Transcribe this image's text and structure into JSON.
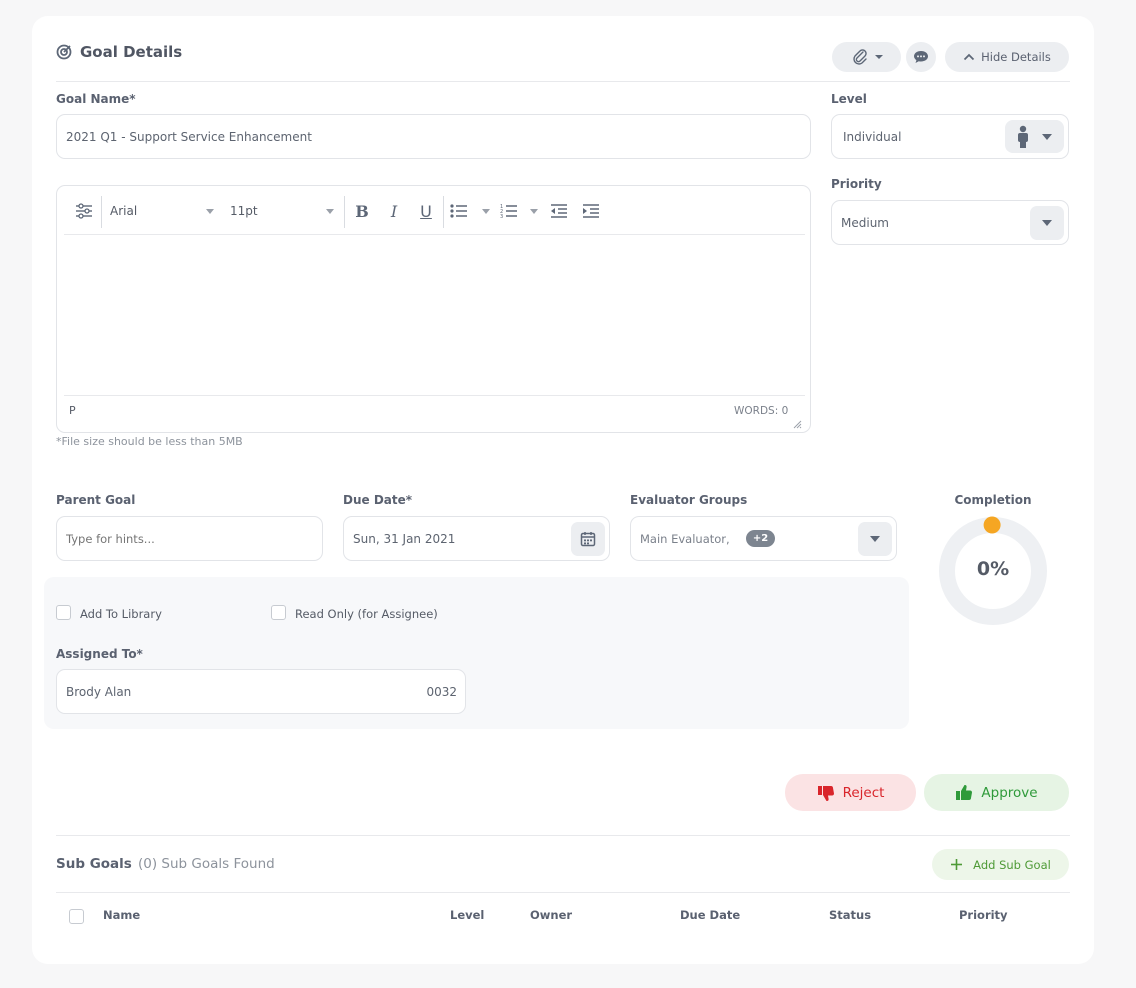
{
  "header": {
    "title": "Goal Details",
    "hide_details_label": "Hide Details"
  },
  "goal_name": {
    "label": "Goal Name*",
    "value": "2021 Q1 - Support Service Enhancement"
  },
  "level": {
    "label": "Level",
    "value": "Individual"
  },
  "priority": {
    "label": "Priority",
    "value": "Medium"
  },
  "editor": {
    "font": "Arial",
    "size": "11pt",
    "status_tag": "P",
    "word_count": "WORDS: 0",
    "file_note": "*File size should be less than 5MB"
  },
  "parent_goal": {
    "label": "Parent Goal",
    "placeholder": "Type for hints..."
  },
  "due_date": {
    "label": "Due Date*",
    "value": "Sun, 31 Jan 2021"
  },
  "evaluator_groups": {
    "label": "Evaluator Groups",
    "value": "Main Evaluator,",
    "extra_count": "+2"
  },
  "completion": {
    "label": "Completion",
    "percent_text": "0%",
    "value": 0
  },
  "options": {
    "add_to_library": "Add To Library",
    "read_only": "Read Only (for Assignee)"
  },
  "assigned_to": {
    "label": "Assigned To*",
    "name": "Brody Alan",
    "code": "0032"
  },
  "actions": {
    "reject": "Reject",
    "approve": "Approve"
  },
  "sub_goals": {
    "title": "Sub Goals",
    "count_text": "(0) Sub Goals Found",
    "add_label": "Add Sub Goal",
    "columns": [
      "Name",
      "Level",
      "Owner",
      "Due Date",
      "Status",
      "Priority"
    ]
  },
  "colors": {
    "reject_bg": "#fbe3e4",
    "reject_fg": "#d9252b",
    "approve_bg": "#e6f4e4",
    "approve_fg": "#2f9a3a",
    "add_bg": "#edf6e9",
    "add_fg": "#4e9a36",
    "completion_knob": "#f5a623"
  }
}
